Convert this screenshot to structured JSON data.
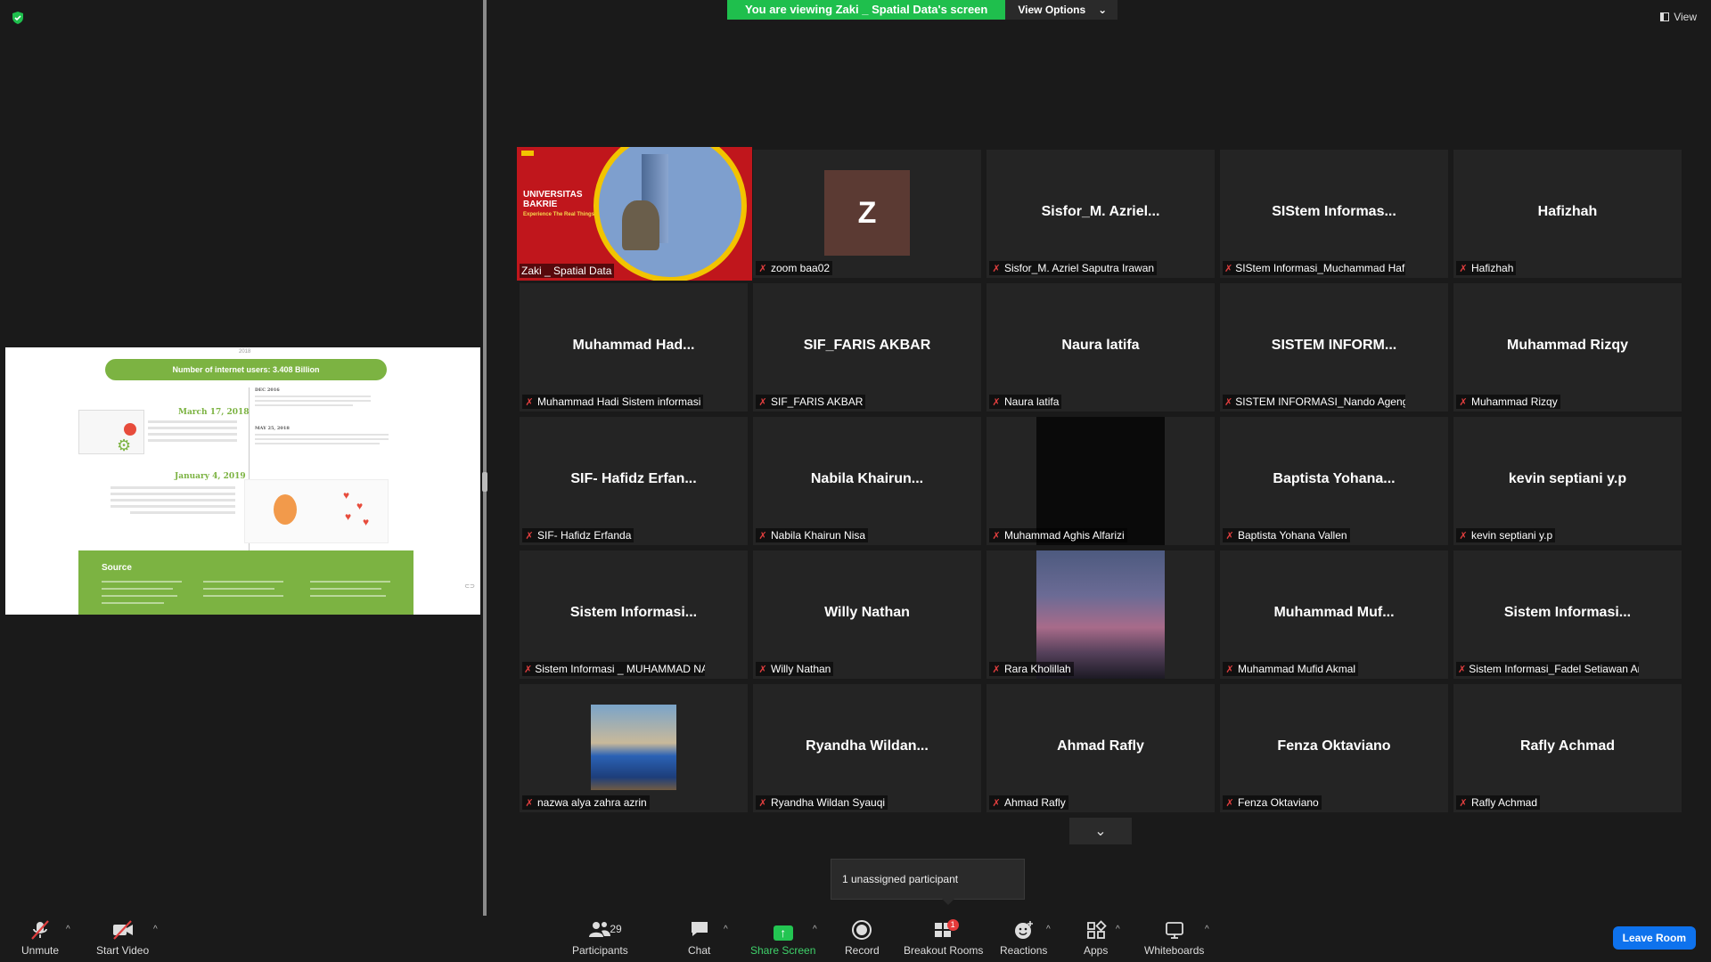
{
  "meeting": {
    "banner_text": "You are viewing Zaki _ Spatial Data's screen",
    "view_options_label": "View Options",
    "view_label": "View"
  },
  "slide": {
    "year": "2018",
    "header": "Number of internet users: 3.408 Billion",
    "date1": "March 17, 2018",
    "date2": "January 4, 2019",
    "side1": "DEC 2016",
    "side2": "MAY 25, 2018",
    "source_title": "Source"
  },
  "tiles": [
    {
      "display": "",
      "label": "Zaki _ Spatial Data",
      "active": true,
      "kind": "uni",
      "muted": false
    },
    {
      "display": "Z",
      "label": "zoom baa02",
      "kind": "initial",
      "muted": true
    },
    {
      "display": "Sisfor_M.  Azriel...",
      "label": "Sisfor_M. Azriel Saputra Irawan",
      "kind": "name",
      "muted": true
    },
    {
      "display": "SIStem  Informas...",
      "label": "SIStem Informasi_Muchammad Hafizh",
      "kind": "name",
      "muted": true
    },
    {
      "display": "Hafizhah",
      "label": "Hafizhah",
      "kind": "name",
      "muted": true
    },
    {
      "display": "Muhammad  Had...",
      "label": "Muhammad Hadi Sistem informasi",
      "kind": "name",
      "muted": true
    },
    {
      "display": "SIF_FARIS AKBAR",
      "label": "SIF_FARIS AKBAR",
      "kind": "name",
      "muted": true
    },
    {
      "display": "Naura latifa",
      "label": "Naura latifa",
      "kind": "name",
      "muted": true
    },
    {
      "display": "SISTEM  INFORM...",
      "label": "SISTEM INFORMASI_Nando Ageng S",
      "kind": "name",
      "muted": true
    },
    {
      "display": "Muhammad Rizqy",
      "label": "Muhammad Rizqy",
      "kind": "name",
      "muted": true
    },
    {
      "display": "SIF- Hafidz  Erfan...",
      "label": "SIF- Hafidz Erfanda",
      "kind": "name",
      "muted": true
    },
    {
      "display": "Nabila  Khairun...",
      "label": "Nabila Khairun Nisa",
      "kind": "name",
      "muted": true
    },
    {
      "display": "",
      "label": "Muhammad Aghis Alfarizi",
      "kind": "dark",
      "muted": true
    },
    {
      "display": "Baptista  Yohana...",
      "label": "Baptista Yohana Vallen",
      "kind": "name",
      "muted": true
    },
    {
      "display": "kevin septiani y.p",
      "label": "kevin septiani y.p",
      "kind": "name",
      "muted": true
    },
    {
      "display": "Sistem  Informasi...",
      "label": "Sistem Informasi _ MUHAMMAD NAW...",
      "kind": "name",
      "muted": true
    },
    {
      "display": "Willy Nathan",
      "label": "Willy Nathan",
      "kind": "name",
      "muted": true
    },
    {
      "display": "",
      "label": "Rara Kholillah",
      "kind": "sky",
      "muted": true
    },
    {
      "display": "Muhammad  Muf...",
      "label": "Muhammad Mufid Akmal",
      "kind": "name",
      "muted": true
    },
    {
      "display": "Sistem  Informasi...",
      "label": "Sistem Informasi_Fadel Setiawan Arfin",
      "kind": "name",
      "muted": true
    },
    {
      "display": "",
      "label": "nazwa alya zahra azrin",
      "kind": "photo",
      "muted": true
    },
    {
      "display": "Ryandha  Wildan...",
      "label": "Ryandha Wildan Syauqi",
      "kind": "name",
      "muted": true
    },
    {
      "display": "Ahmad Rafly",
      "label": "Ahmad Rafly",
      "kind": "name",
      "muted": true
    },
    {
      "display": "Fenza Oktaviano",
      "label": "Fenza Oktaviano",
      "kind": "name",
      "muted": true
    },
    {
      "display": "Rafly Achmad",
      "label": "Rafly Achmad",
      "kind": "name",
      "muted": true
    }
  ],
  "uni_tile": {
    "line1": "UNIVERSITAS",
    "line2": "BAKRIE",
    "tagline": "Experience The Real Things"
  },
  "popup": {
    "text": "1 unassigned participant"
  },
  "toolbar": {
    "unmute": "Unmute",
    "start_video": "Start Video",
    "participants": "Participants",
    "participants_count": "29",
    "chat": "Chat",
    "share_screen": "Share Screen",
    "record": "Record",
    "breakout_rooms": "Breakout Rooms",
    "breakout_badge": "1",
    "reactions": "Reactions",
    "apps": "Apps",
    "whiteboards": "Whiteboards",
    "leave_room": "Leave Room"
  },
  "colors": {
    "accent_green": "#1fbf4d",
    "active_border": "#f0e040",
    "leave_blue": "#0e72ed",
    "muted_red": "#e03e3e"
  }
}
